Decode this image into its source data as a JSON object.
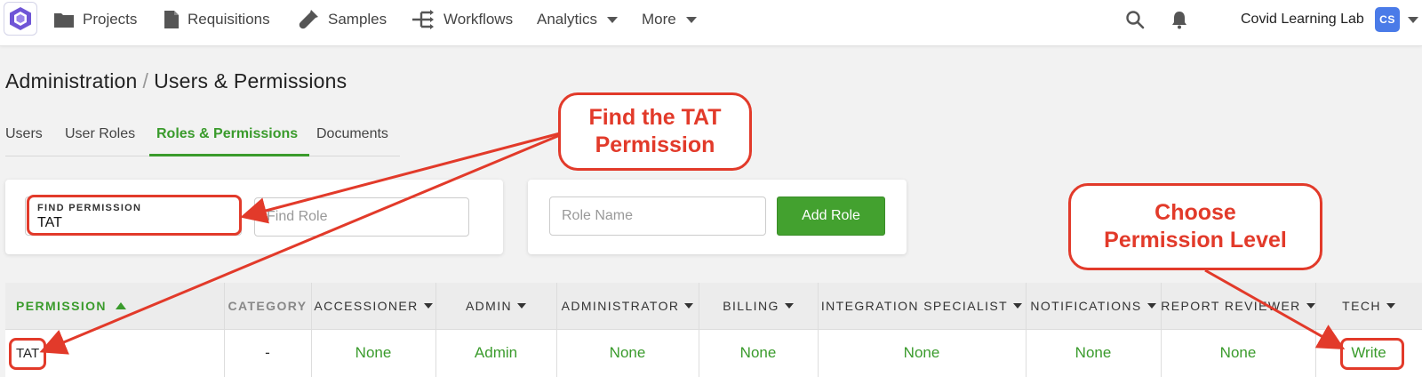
{
  "nav": {
    "items": [
      {
        "label": "Projects",
        "icon": "folder-icon"
      },
      {
        "label": "Requisitions",
        "icon": "document-icon"
      },
      {
        "label": "Samples",
        "icon": "test-tube-icon"
      },
      {
        "label": "Workflows",
        "icon": "workflow-icon"
      },
      {
        "label": "Analytics",
        "icon": "caret-down-icon"
      },
      {
        "label": "More",
        "icon": "caret-down-icon"
      }
    ],
    "lab_name": "Covid Learning Lab",
    "avatar_initials": "CS"
  },
  "breadcrumb": {
    "section": "Administration",
    "separator": "/",
    "page": "Users & Permissions"
  },
  "tabs": [
    {
      "label": "Users",
      "active": false
    },
    {
      "label": "User Roles",
      "active": false
    },
    {
      "label": "Roles & Permissions",
      "active": true
    },
    {
      "label": "Documents",
      "active": false
    }
  ],
  "filters": {
    "find_permission_label": "FIND PERMISSION",
    "find_permission_value": "TAT",
    "find_role_placeholder": "Find Role"
  },
  "add_role": {
    "role_name_placeholder": "Role Name",
    "button_label": "Add Role"
  },
  "table": {
    "columns": [
      {
        "label": "PERMISSION",
        "sort": "asc"
      },
      {
        "label": "CATEGORY"
      },
      {
        "label": "ACCESSIONER",
        "dropdown": true
      },
      {
        "label": "ADMIN",
        "dropdown": true
      },
      {
        "label": "ADMINISTRATOR",
        "dropdown": true
      },
      {
        "label": "BILLING",
        "dropdown": true
      },
      {
        "label": "INTEGRATION SPECIALIST",
        "dropdown": true
      },
      {
        "label": "NOTIFICATIONS",
        "dropdown": true
      },
      {
        "label": "REPORT REVIEWER",
        "dropdown": true
      },
      {
        "label": "TECH",
        "dropdown": true
      }
    ],
    "rows": [
      [
        "TAT",
        "-",
        "None",
        "Admin",
        "None",
        "None",
        "None",
        "None",
        "None",
        "Write"
      ]
    ]
  },
  "annotations": {
    "find_tat": [
      "Find the TAT",
      "Permission"
    ],
    "choose_level": [
      "Choose",
      "Permission Level"
    ]
  },
  "colors": {
    "accent_green": "#3a9b2c",
    "annotation_red": "#e23a2a",
    "avatar_blue": "#4a7be8"
  }
}
